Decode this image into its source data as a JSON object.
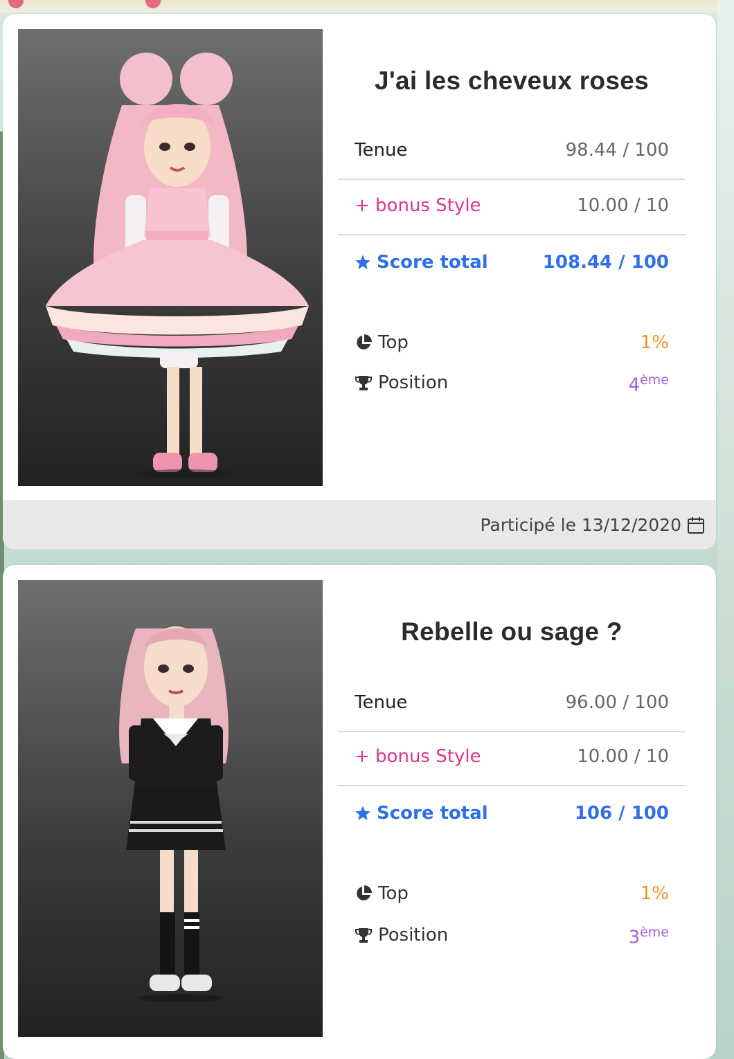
{
  "entries": [
    {
      "title": "J'ai les cheveux roses",
      "tenue_label": "Tenue",
      "tenue_value": "98.44 / 100",
      "bonus_label": "+ bonus Style",
      "bonus_value": "10.00 / 10",
      "score_label": "Score total",
      "score_value": "108.44 / 100",
      "top_label": "Top",
      "top_value": "1%",
      "position_label": "Position",
      "position_number": "4",
      "position_suffix": "ème",
      "participation": "Participé le 13/12/2020"
    },
    {
      "title": "Rebelle ou sage ?",
      "tenue_label": "Tenue",
      "tenue_value": "96.00 / 100",
      "bonus_label": "+ bonus Style",
      "bonus_value": "10.00 / 10",
      "score_label": "Score total",
      "score_value": "106 / 100",
      "top_label": "Top",
      "top_value": "1%",
      "position_label": "Position",
      "position_number": "3",
      "position_suffix": "ème"
    }
  ],
  "icons": {
    "score": "star-icon",
    "top": "pie-chart-icon",
    "position": "trophy-icon",
    "date": "calendar-icon",
    "avatar1": "avatar-pink-dress-image",
    "avatar2": "avatar-black-sailor-dress-image"
  },
  "colors": {
    "bonus": "#e0338a",
    "score": "#2f6fe8",
    "top": "#f0912a",
    "position": "#a45fd6"
  }
}
